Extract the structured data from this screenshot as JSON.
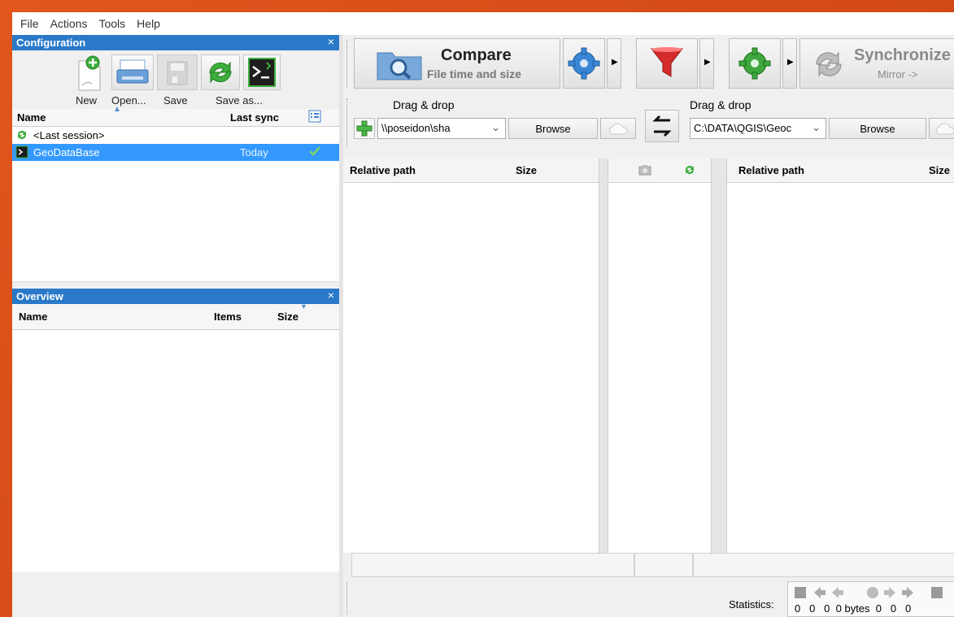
{
  "menu": [
    "File",
    "Actions",
    "Tools",
    "Help"
  ],
  "config_panel": {
    "title": "Configuration",
    "close": "×",
    "toolbar": [
      "New",
      "Open...",
      "Save",
      "Save as..."
    ],
    "columns": {
      "name": "Name",
      "last_sync": "Last sync"
    },
    "rows": [
      {
        "name": "<Last session>",
        "last_sync": ""
      },
      {
        "name": "GeoDataBase",
        "last_sync": "Today"
      }
    ]
  },
  "overview_panel": {
    "title": "Overview",
    "close": "×",
    "columns": {
      "name": "Name",
      "items": "Items",
      "size": "Size"
    }
  },
  "compare": {
    "title": "Compare",
    "subtitle": "File time and size"
  },
  "synchronize": {
    "title": "Synchronize",
    "subtitle": "Mirror ->"
  },
  "left_folder": {
    "drop_label": "Drag & drop",
    "path": "\\\\poseidon\\sha",
    "browse": "Browse"
  },
  "right_folder": {
    "drop_label": "Drag & drop",
    "path": "C:\\DATA\\QGIS\\Geoc",
    "browse": "Browse"
  },
  "grid_left": {
    "relative_path": "Relative path",
    "size": "Size"
  },
  "grid_right": {
    "relative_path": "Relative path",
    "size": "Size"
  },
  "statistics": {
    "label": "Statistics:",
    "values": [
      "0",
      "0",
      "0",
      "0 bytes",
      "0",
      "0",
      "0"
    ]
  },
  "colors": {
    "title_bar": "#2a79c9",
    "selection": "#3399ff",
    "accent_bg": "#d8501b"
  }
}
